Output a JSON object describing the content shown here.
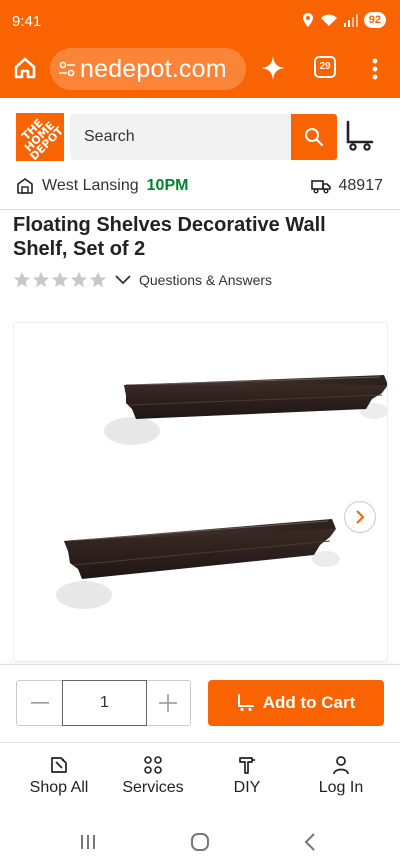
{
  "status_bar": {
    "time": "9:41",
    "battery": "92"
  },
  "browser": {
    "url": "nedepot.com",
    "tab_count": "29"
  },
  "header": {
    "logo_text": "THE HOME DEPOT",
    "search_placeholder": "Search"
  },
  "store": {
    "name": "West Lansing",
    "hours": "10PM",
    "delivery_zip": "48917"
  },
  "product": {
    "title": "Floating Shelves Decorative Wall Shelf, Set of 2",
    "rating": 0,
    "rating_max": 5,
    "qa_label": "Questions & Answers"
  },
  "cart": {
    "quantity": "1",
    "add_to_cart_label": "Add to Cart"
  },
  "bottom_nav": [
    {
      "label": "Shop All",
      "icon": "shop-all-icon"
    },
    {
      "label": "Services",
      "icon": "services-icon"
    },
    {
      "label": "DIY",
      "icon": "diy-icon"
    },
    {
      "label": "Log In",
      "icon": "user-icon"
    }
  ],
  "colors": {
    "brand": "#f96302",
    "store_hours": "#00852b"
  }
}
